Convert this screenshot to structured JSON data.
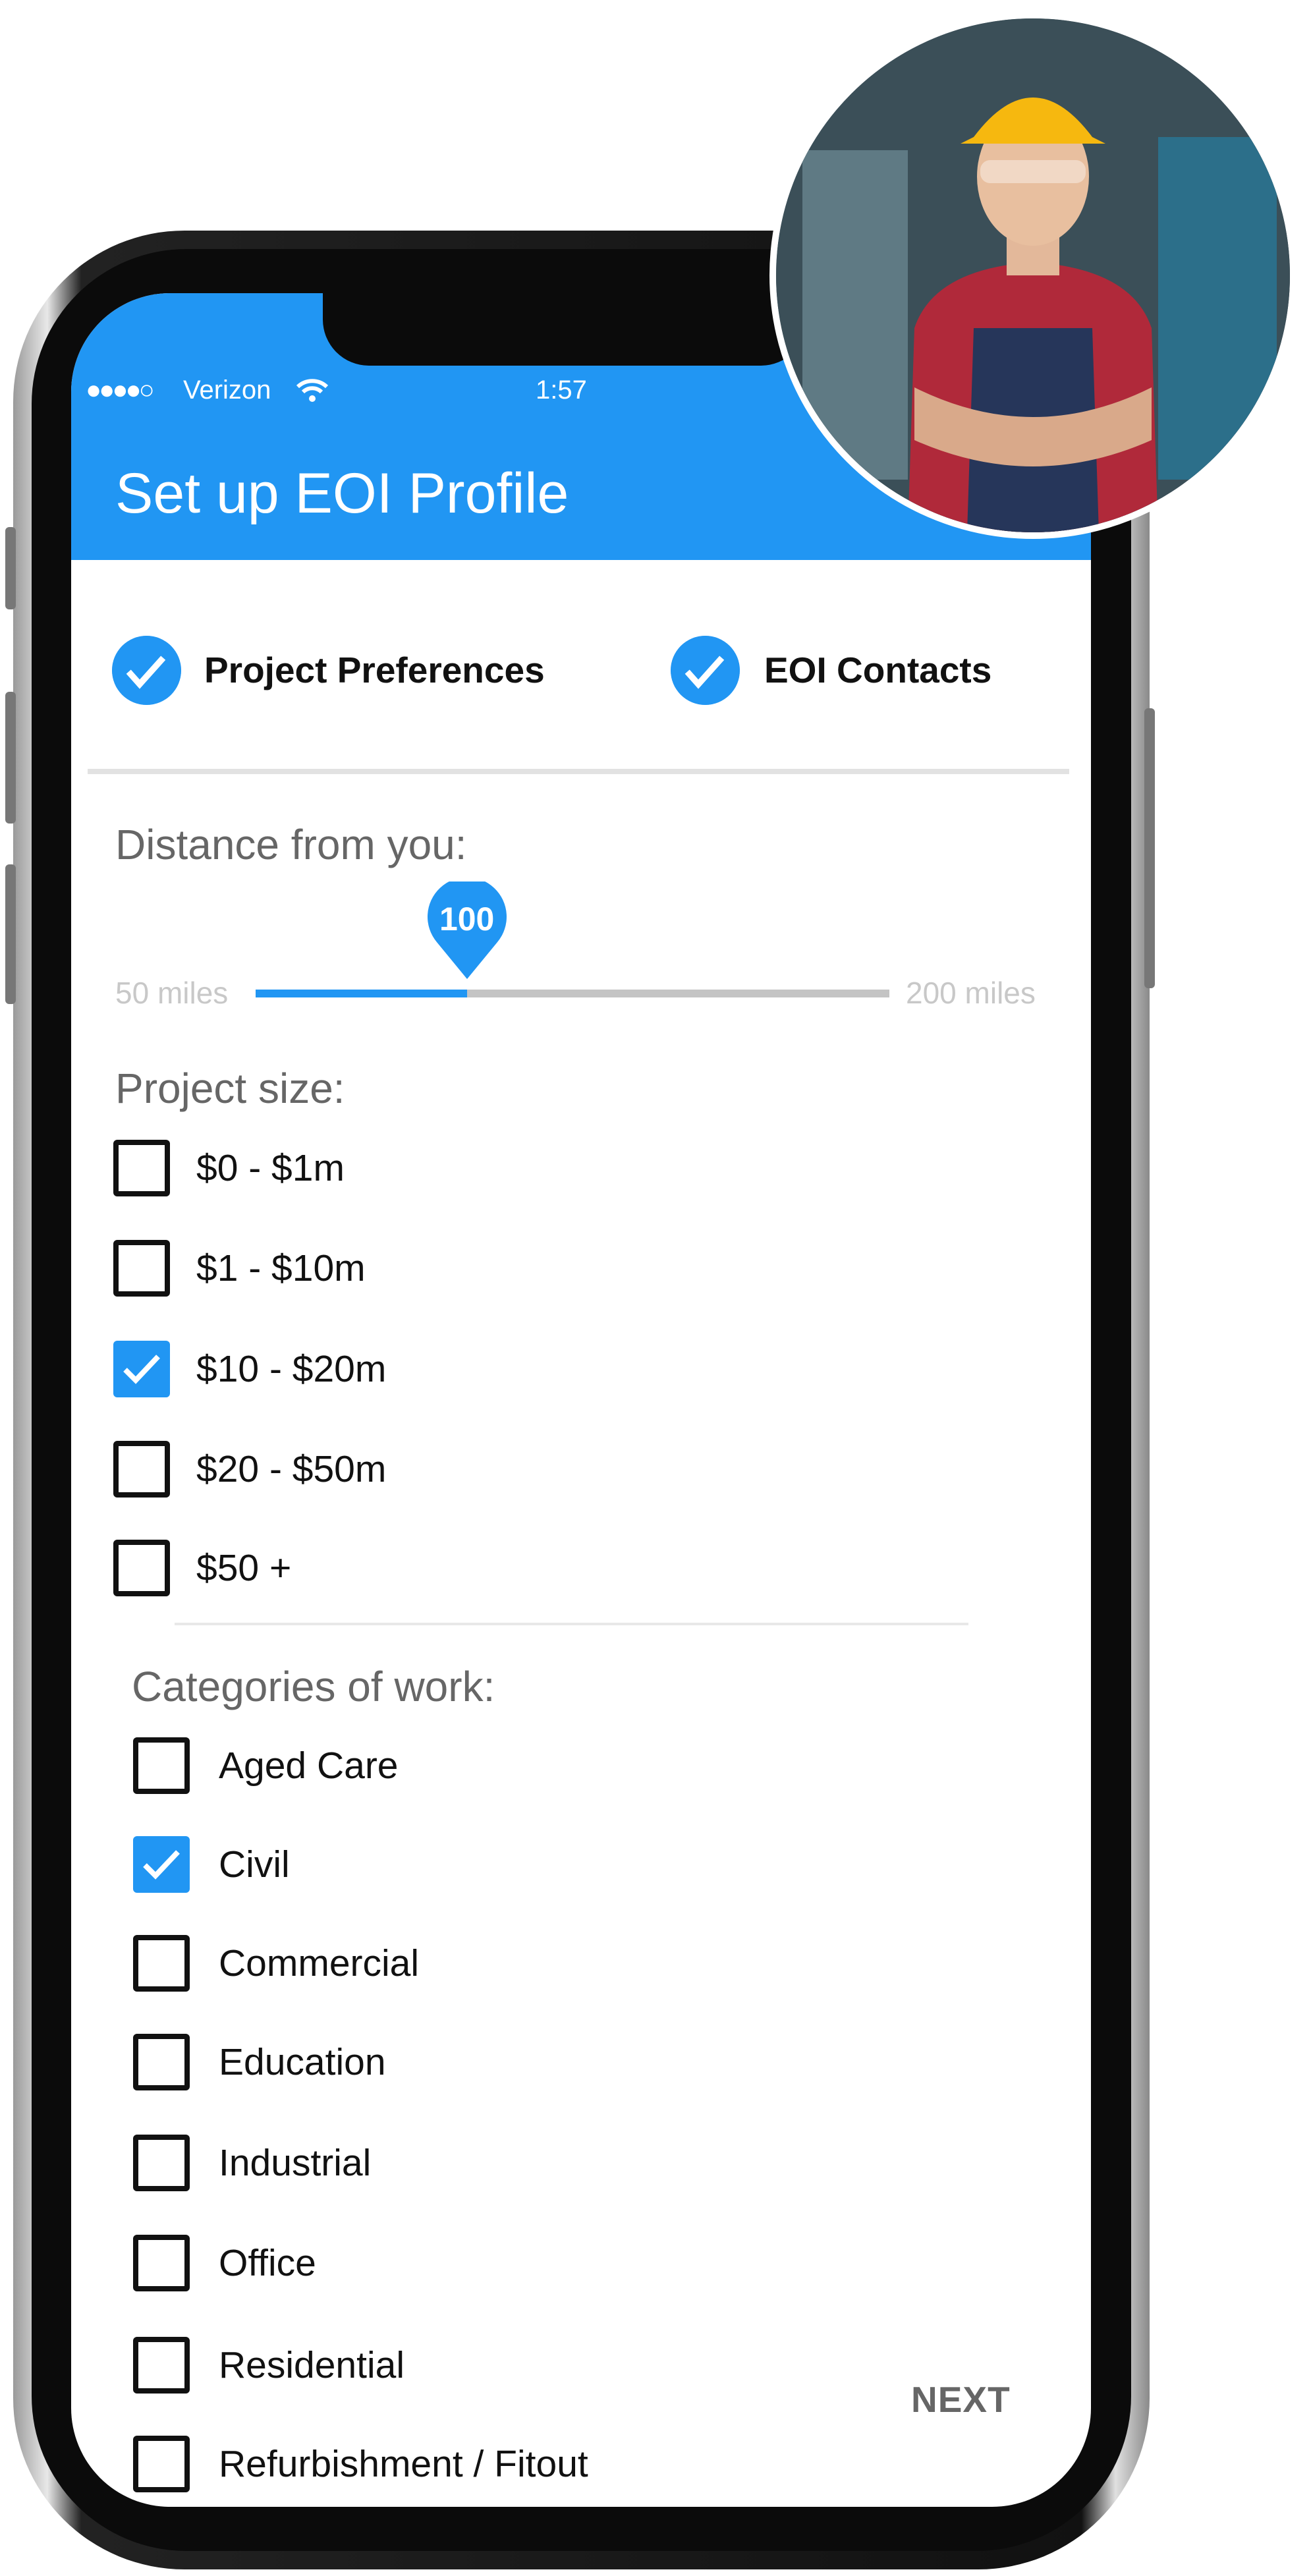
{
  "status_bar": {
    "carrier": "Verizon",
    "signal": "●●●●○",
    "time": "1:57",
    "wifi_icon": "wifi-icon"
  },
  "header": {
    "title": "Set up EOI Profile"
  },
  "steps": [
    {
      "label": "Project Preferences",
      "done": true
    },
    {
      "label": "EOI Contacts",
      "done": true
    }
  ],
  "distance": {
    "label": "Distance from you:",
    "min_label": "50 miles",
    "max_label": "200 miles",
    "value": "100",
    "min": 50,
    "max": 200,
    "current": 100
  },
  "project_size": {
    "label": "Project size:",
    "options": [
      {
        "label": "$0 - $1m",
        "checked": false
      },
      {
        "label": "$1 - $10m",
        "checked": false
      },
      {
        "label": "$10 - $20m",
        "checked": true
      },
      {
        "label": "$20 - $50m",
        "checked": false
      },
      {
        "label": "$50 +",
        "checked": false
      }
    ]
  },
  "categories": {
    "label": "Categories of work:",
    "options": [
      {
        "label": "Aged Care",
        "checked": false
      },
      {
        "label": "Civil",
        "checked": true
      },
      {
        "label": "Commercial",
        "checked": false
      },
      {
        "label": "Education",
        "checked": false
      },
      {
        "label": "Industrial",
        "checked": false
      },
      {
        "label": "Office",
        "checked": false
      },
      {
        "label": "Residential",
        "checked": false
      },
      {
        "label": "Refurbishment / Fitout",
        "checked": false
      }
    ]
  },
  "next_label": "NEXT",
  "colors": {
    "accent": "#2196F3",
    "label_gray": "#666666"
  }
}
